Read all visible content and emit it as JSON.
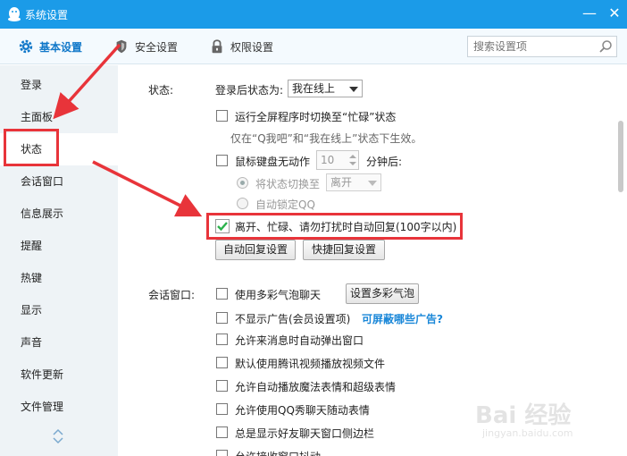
{
  "window": {
    "title": "系统设置",
    "minimize_glyph": "—",
    "close_glyph": "✕"
  },
  "toolbar": {
    "tabs": [
      {
        "label": "基本设置",
        "icon": "gear-icon",
        "active": true
      },
      {
        "label": "安全设置",
        "icon": "shield-icon",
        "active": false
      },
      {
        "label": "权限设置",
        "icon": "lock-icon",
        "active": false
      }
    ],
    "search_placeholder": "搜索设置项"
  },
  "sidebar": {
    "items": [
      {
        "label": "登录"
      },
      {
        "label": "主面板"
      },
      {
        "label": "状态",
        "selected": true
      },
      {
        "label": "会话窗口"
      },
      {
        "label": "信息展示"
      },
      {
        "label": "提醒"
      },
      {
        "label": "热键"
      },
      {
        "label": "显示"
      },
      {
        "label": "声音"
      },
      {
        "label": "软件更新"
      },
      {
        "label": "文件管理"
      }
    ]
  },
  "status_section": {
    "heading": "状态:",
    "after_login_label": "登录后状态为:",
    "after_login_value": "我在线上",
    "fullscreen_busy": {
      "label": "运行全屏程序时切换至“忙碌”状态",
      "checked": false
    },
    "fullscreen_hint": "仅在“Q我吧”和“我在线上”状态下生效。",
    "idle": {
      "label": "鼠标键盘无动作",
      "minutes_value": "10",
      "minutes_suffix": "分钟后:",
      "checked": false
    },
    "switch_to": {
      "label": "将状态切换至",
      "value": "离开",
      "selected": true
    },
    "auto_lock": {
      "label": "自动锁定QQ",
      "selected": false
    },
    "auto_reply": {
      "label": "离开、忙碌、请勿打扰时自动回复(100字以内)",
      "checked": true
    },
    "auto_reply_settings_button": "自动回复设置",
    "quick_reply_settings_button": "快捷回复设置"
  },
  "chat_section": {
    "heading": "会话窗口:",
    "options": [
      {
        "label": "使用多彩气泡聊天",
        "checked": false
      },
      {
        "label": "不显示广告(会员设置项)",
        "checked": false
      },
      {
        "label": "允许来消息时自动弹出窗口",
        "checked": false
      },
      {
        "label": "默认使用腾讯视频播放视频文件",
        "checked": false
      },
      {
        "label": "允许自动播放魔法表情和超级表情",
        "checked": false
      },
      {
        "label": "允许使用QQ秀聊天随动表情",
        "checked": false
      },
      {
        "label": "总是显示好友聊天窗口侧边栏",
        "checked": false
      },
      {
        "label": "允许接收窗口抖动",
        "checked": false
      }
    ],
    "bubble_button": "设置多彩气泡",
    "ads_link": "可屏蔽哪些广告?"
  },
  "colors": {
    "titlebar": "#1b9be8",
    "accent": "#1178c9",
    "annotation_red": "#e8343a",
    "checkbox_green": "#2bb24c"
  },
  "watermark": {
    "line1": "Bai 经验",
    "line2": "jingyan.baidu.com"
  }
}
